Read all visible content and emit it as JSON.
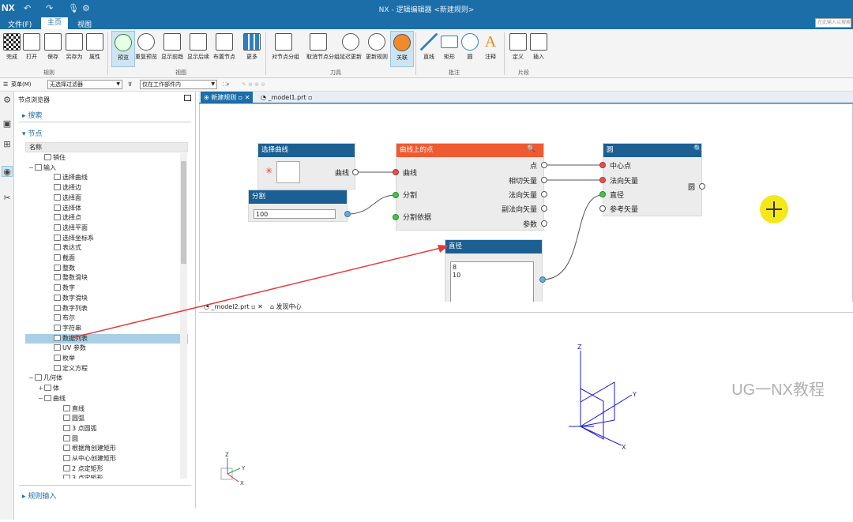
{
  "titlebar": {
    "logo": "NX",
    "title": "NX - 逻辑编辑器 <新建规则>"
  },
  "menubar": {
    "items": [
      "文件(F)",
      "主页",
      "视图"
    ],
    "search_placeholder": "在此输入以搜索"
  },
  "ribbon": {
    "buttons": [
      "完成",
      "打开",
      "保存",
      "另存为",
      "属性",
      "预览",
      "重复预览",
      "显示前趋",
      "显示后续",
      "布置节点",
      "更多",
      "对节点分组",
      "取消节点分组",
      "延迟更新",
      "更新规则",
      "关联",
      "直线",
      "矩形",
      "圆",
      "注释",
      "定义",
      "插入"
    ],
    "groups": [
      "规则",
      "视图",
      "刀具",
      "批注",
      "片段"
    ]
  },
  "toolbar2": {
    "menu_label": "菜单(M)",
    "filter": "无选择过滤器",
    "scope": "仅在工作部件内"
  },
  "navigator": {
    "title": "节点浏览器",
    "sections": {
      "search": "搜索",
      "nodes": "节点",
      "rule_input": "规则输入"
    },
    "tree_header": "名称",
    "tree": [
      {
        "label": "销住",
        "indent": 1,
        "exp": ""
      },
      {
        "label": "输入",
        "indent": 0,
        "exp": "−"
      },
      {
        "label": "选择曲线",
        "indent": 2,
        "exp": ""
      },
      {
        "label": "选择边",
        "indent": 2,
        "exp": ""
      },
      {
        "label": "选择面",
        "indent": 2,
        "exp": ""
      },
      {
        "label": "选择体",
        "indent": 2,
        "exp": ""
      },
      {
        "label": "选择点",
        "indent": 2,
        "exp": ""
      },
      {
        "label": "选择平面",
        "indent": 2,
        "exp": ""
      },
      {
        "label": "选择坐标系",
        "indent": 2,
        "exp": ""
      },
      {
        "label": "表达式",
        "indent": 2,
        "exp": ""
      },
      {
        "label": "截面",
        "indent": 2,
        "exp": ""
      },
      {
        "label": "整数",
        "indent": 2,
        "exp": ""
      },
      {
        "label": "整数滑块",
        "indent": 2,
        "exp": ""
      },
      {
        "label": "数字",
        "indent": 2,
        "exp": ""
      },
      {
        "label": "数字滑块",
        "indent": 2,
        "exp": ""
      },
      {
        "label": "数字列表",
        "indent": 2,
        "exp": ""
      },
      {
        "label": "布尔",
        "indent": 2,
        "exp": ""
      },
      {
        "label": "字符串",
        "indent": 2,
        "exp": ""
      },
      {
        "label": "数据列表",
        "indent": 2,
        "exp": "",
        "selected": true
      },
      {
        "label": "UV 参数",
        "indent": 2,
        "exp": ""
      },
      {
        "label": "枚举",
        "indent": 2,
        "exp": ""
      },
      {
        "label": "定义方程",
        "indent": 2,
        "exp": ""
      },
      {
        "label": "几何体",
        "indent": 0,
        "exp": "−"
      },
      {
        "label": "体",
        "indent": 1,
        "exp": "+"
      },
      {
        "label": "曲线",
        "indent": 1,
        "exp": "−"
      },
      {
        "label": "直线",
        "indent": 3,
        "exp": ""
      },
      {
        "label": "圆弧",
        "indent": 3,
        "exp": ""
      },
      {
        "label": "3 点圆弧",
        "indent": 3,
        "exp": ""
      },
      {
        "label": "圆",
        "indent": 3,
        "exp": ""
      },
      {
        "label": "根据角创建矩形",
        "indent": 3,
        "exp": ""
      },
      {
        "label": "从中心创建矩形",
        "indent": 3,
        "exp": ""
      },
      {
        "label": "2 点定矩形",
        "indent": 3,
        "exp": ""
      },
      {
        "label": "3 点定矩形",
        "indent": 3,
        "exp": ""
      }
    ]
  },
  "tabs": {
    "rule": "新建规则",
    "model1": "_model1.prt",
    "model2": "_model2.prt",
    "discovery": "发现中心"
  },
  "nodes": {
    "select_curve": {
      "title": "选择曲线",
      "out": "曲线"
    },
    "split": {
      "title": "分割",
      "value": "100"
    },
    "point_on_curve": {
      "title": "曲线上的点",
      "in": [
        "曲线",
        "分割",
        "分割依据"
      ],
      "out": [
        "点",
        "相切矢量",
        "法向矢量",
        "副法向矢量",
        "参数"
      ]
    },
    "circle": {
      "title": "圆",
      "in": [
        "中心点",
        "法向矢量",
        "直径",
        "参考矢量"
      ],
      "out": "圆"
    },
    "diameter": {
      "title": "直径",
      "values": [
        "8",
        "10"
      ]
    }
  },
  "triad": {
    "x": "X",
    "y": "Y",
    "z": "Z"
  },
  "watermark": "UG一NX教程"
}
